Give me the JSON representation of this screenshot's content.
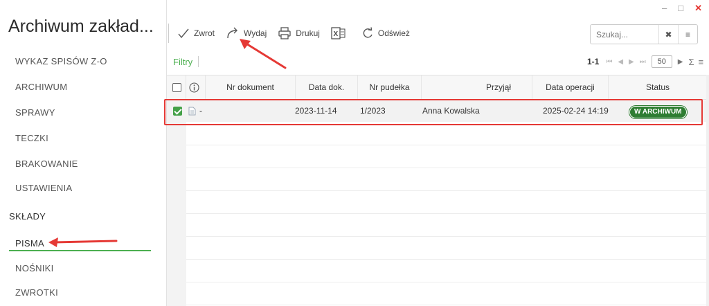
{
  "window": {
    "minimize": "–",
    "maximize": "□",
    "close": "✕"
  },
  "app": {
    "title": "Archiwum zakład..."
  },
  "sidebar": {
    "items": [
      {
        "label": "WYKAZ SPISÓW Z-O"
      },
      {
        "label": "ARCHIWUM"
      },
      {
        "label": "SPRAWY"
      },
      {
        "label": "TECZKI"
      },
      {
        "label": "BRAKOWANIE"
      },
      {
        "label": "USTAWIENIA"
      }
    ],
    "section": "SKŁADY",
    "section_items": [
      {
        "label": "PISMA",
        "active": true
      },
      {
        "label": "NOŚNIKI"
      },
      {
        "label": "ZWROTKI"
      }
    ]
  },
  "toolbar": {
    "zwrot": "Zwrot",
    "wydaj": "Wydaj",
    "drukuj": "Drukuj",
    "excel_icon": "excel-icon",
    "odswiez": "Odśwież"
  },
  "search": {
    "placeholder": "Szukaj...",
    "clear_icon": "✖",
    "menu_icon": "≡"
  },
  "filters": {
    "label": "Filtry"
  },
  "pager": {
    "range": "1-1",
    "page_size": "50",
    "sum_icon": "Σ",
    "menu_icon": "≡"
  },
  "grid": {
    "columns": [
      "Nr dokument",
      "Data dok.",
      "Nr pudełka",
      "Przyjął",
      "Data operacji",
      "Status"
    ],
    "rows": [
      {
        "nr_dokument": "-",
        "data_dok": "2023-11-14",
        "nr_pudelka": "1/2023",
        "przyjal": "Anna Kowalska",
        "data_operacji": "2025-02-24 14:19",
        "status": "W ARCHIWUM",
        "checked": true
      }
    ]
  },
  "colors": {
    "accent": "#4caf50",
    "status_green": "#2e7d32",
    "annotation_red": "#e53935"
  }
}
